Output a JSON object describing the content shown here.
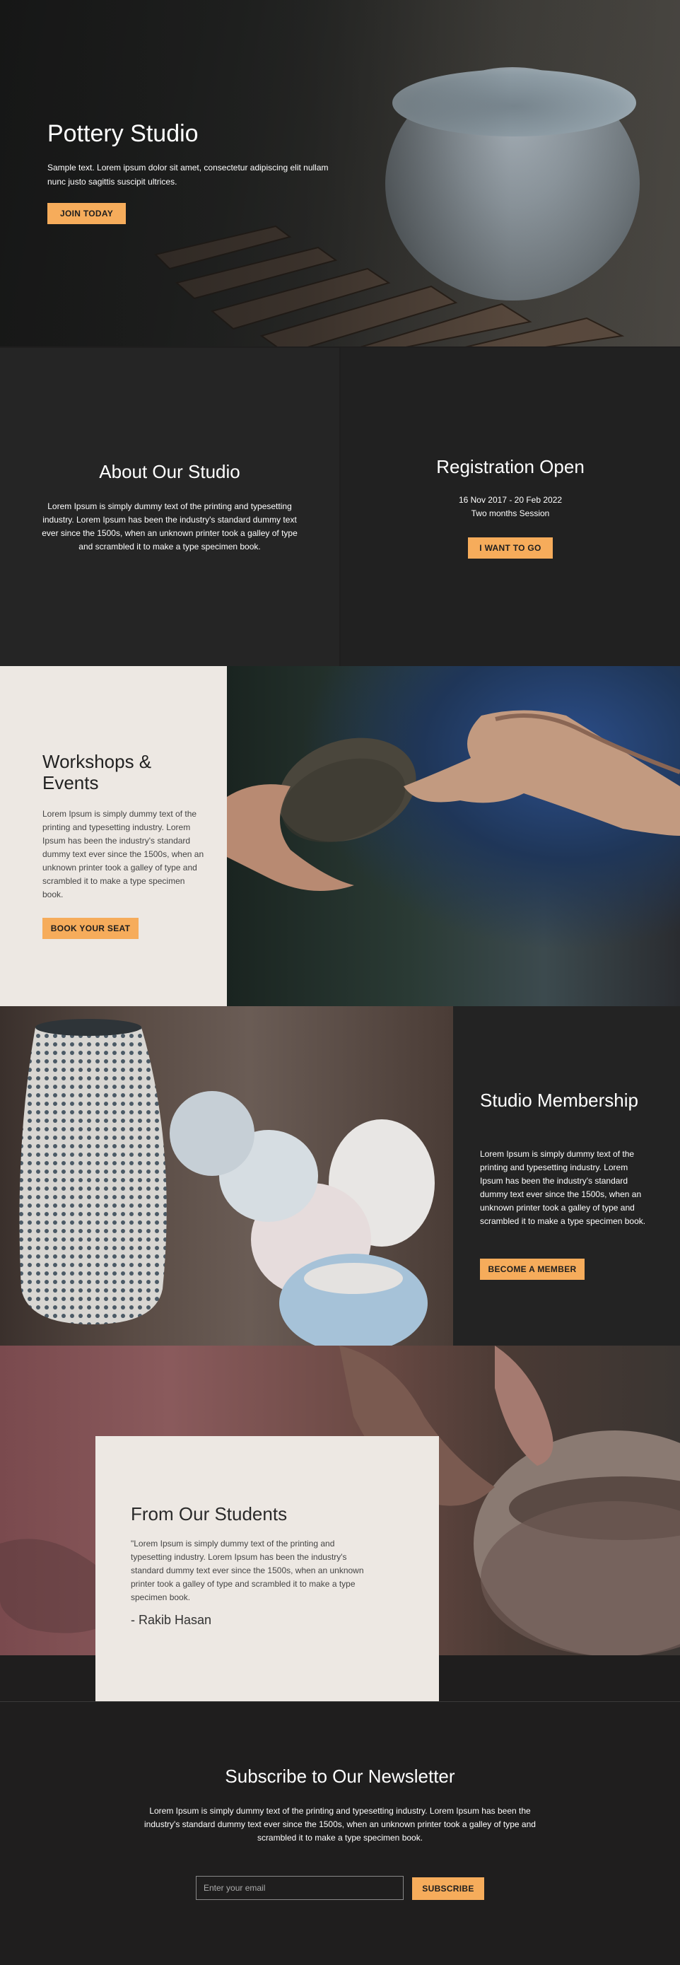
{
  "hero": {
    "title": "Pottery Studio",
    "text": "Sample text. Lorem ipsum dolor sit amet, consectetur adipiscing elit nullam nunc justo sagittis suscipit ultrices.",
    "button": "JOIN TODAY"
  },
  "about": {
    "title": "About Our Studio",
    "text": "Lorem Ipsum is simply dummy text of the printing and typesetting industry. Lorem Ipsum has been the industry's standard dummy text ever since the 1500s, when an unknown printer took a galley of type and scrambled it to make a type specimen book."
  },
  "registration": {
    "title": "Registration Open",
    "dates": "16 Nov 2017 - 20 Feb 2022",
    "session": "Two months Session",
    "button": "I WANT TO GO"
  },
  "workshops": {
    "title": "Workshops & Events",
    "text": "Lorem Ipsum is simply dummy text of the printing and typesetting industry. Lorem Ipsum has been the industry's standard dummy text ever since the 1500s, when an unknown printer took a galley of type and scrambled it to make a type specimen book.",
    "button": "BOOK YOUR SEAT"
  },
  "membership": {
    "title": "Studio Membership",
    "text": "Lorem Ipsum is simply dummy text of the printing and typesetting industry. Lorem Ipsum has been the industry's standard dummy text ever since the 1500s, when an unknown printer took a galley of type and scrambled it to make a type specimen book.",
    "button": "BECOME A MEMBER"
  },
  "students": {
    "title": "From Our Students",
    "quote": "\"Lorem Ipsum is simply dummy text of the printing and typesetting industry. Lorem Ipsum has been the industry's standard dummy text ever since the 1500s, when an unknown printer took a galley of type and scrambled it to make a type specimen book.",
    "author": "- Rakib Hasan"
  },
  "newsletter": {
    "title": "Subscribe to Our Newsletter",
    "text": "Lorem Ipsum is simply dummy text of the printing and typesetting industry. Lorem Ipsum has been the industry's standard dummy text ever since the 1500s, when an unknown printer took a galley of type and scrambled it to make a type specimen book.",
    "placeholder": "Enter your email",
    "button": "SUBSCRIBE"
  },
  "colors": {
    "accent": "#f6ac5b",
    "dark_bg": "#1f1e1e",
    "light_bg": "#ede8e3"
  }
}
